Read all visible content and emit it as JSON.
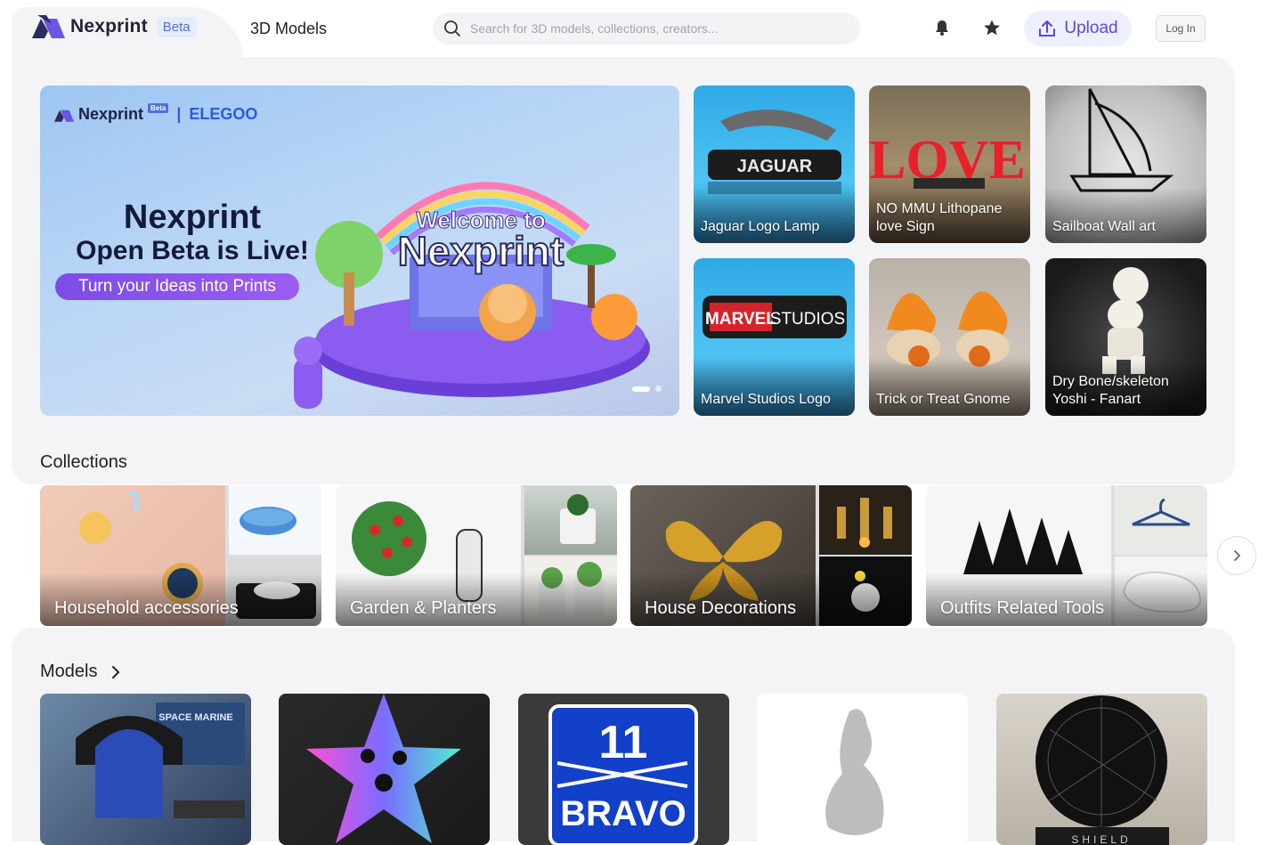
{
  "header": {
    "brand": "Nexprint",
    "badge": "Beta",
    "nav_3d_models": "3D Models",
    "search_placeholder": "Search for 3D models, collections, creators...",
    "upload_label": "Upload",
    "login_label": "Log In"
  },
  "hero": {
    "brand_left": "Nexprint",
    "brand_badge": "Beta",
    "brand_right": "ELEGOO",
    "title_line1": "Nexprint",
    "title_line2": "Open Beta is Live!",
    "pill": "Turn your Ideas into Prints",
    "art_welcome": "Welcome to",
    "art_name": "Nexprint"
  },
  "featured": [
    {
      "title": "Jaguar Logo Lamp",
      "art": "JAGUAR"
    },
    {
      "title": "NO MMU Lithopane love Sign",
      "art": "LOVE"
    },
    {
      "title": "Sailboat Wall art"
    },
    {
      "title": "Marvel Studios Logo",
      "art_a": "MARVEL",
      "art_b": "STUDIOS"
    },
    {
      "title": "Trick or Treat Gnome"
    },
    {
      "title": "Dry Bone/skeleton Yoshi - Fanart"
    }
  ],
  "collections": {
    "title": "Collections",
    "items": [
      {
        "label": "Household accessories"
      },
      {
        "label": "Garden & Planters"
      },
      {
        "label": "House Decorations"
      },
      {
        "label": "Outfits Related Tools"
      }
    ]
  },
  "models": {
    "title": "Models",
    "items": [
      {
        "art": "SPACE MARINE"
      },
      {
        "art": ""
      },
      {
        "art_num": "11",
        "art_word": "BRAVO"
      },
      {
        "art": ""
      },
      {
        "art": "SHIELD"
      }
    ]
  },
  "colors": {
    "accent": "#5b47e0",
    "panel_bg": "#f4f4f6",
    "beta_text": "#4f6fe0"
  }
}
